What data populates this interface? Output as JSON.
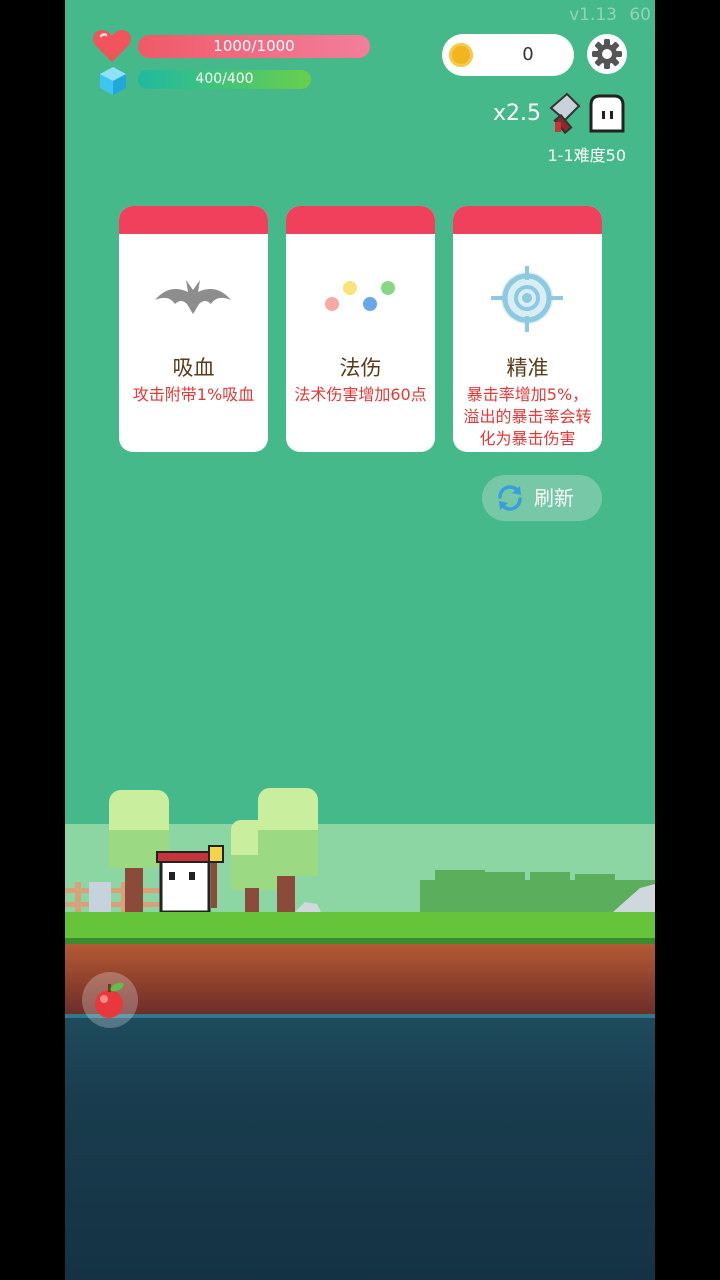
{
  "hud": {
    "version": "v1.13",
    "fps": "60",
    "hp": {
      "text": "1000/1000",
      "ratio": 1.0
    },
    "mp": {
      "text": "400/400",
      "ratio": 1.0
    },
    "coins": "0",
    "speed": "x2.5",
    "stage": "1-1难度50"
  },
  "cards": [
    {
      "title": "吸血",
      "desc": "攻击附带1%吸血",
      "icon": "bat-icon"
    },
    {
      "title": "法伤",
      "desc": "法术伤害增加60点",
      "icon": "magic-orbs-icon"
    },
    {
      "title": "精准",
      "desc": "暴击率增加5%，溢出的暴击率会转化为暴击伤害",
      "icon": "crosshair-icon"
    }
  ],
  "refresh": {
    "label": "刷新"
  },
  "colors": {
    "background": "#46b98a",
    "card_header": "#f1405c",
    "desc_text": "#e53837"
  }
}
